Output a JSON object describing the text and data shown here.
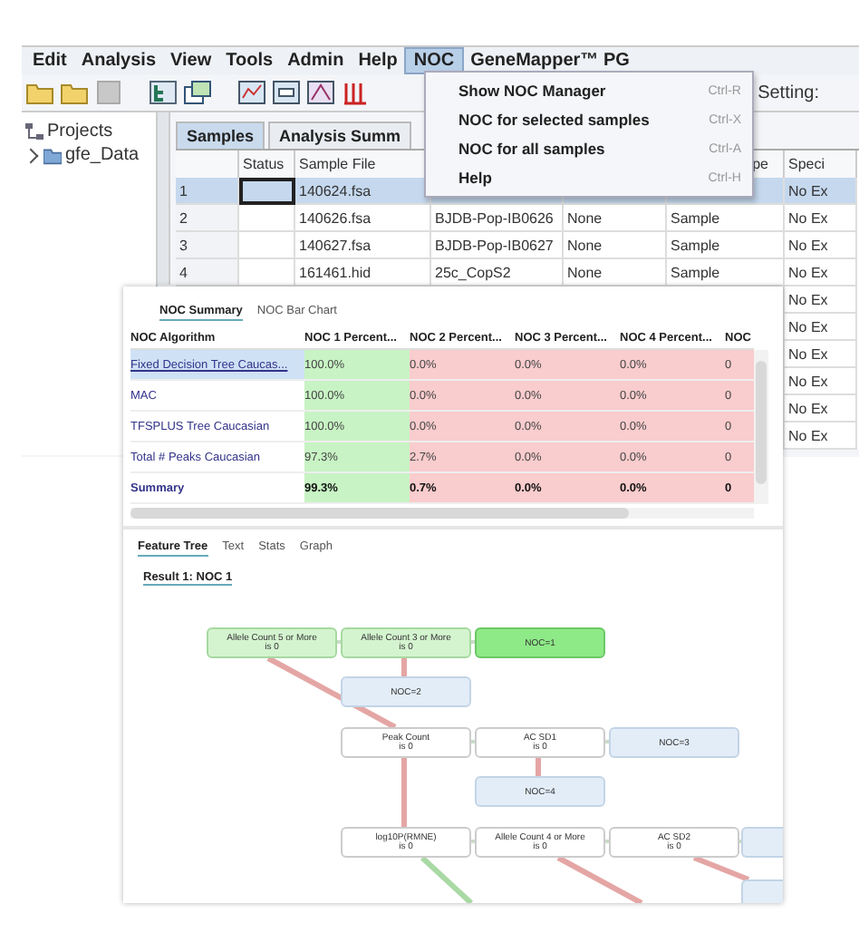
{
  "main_window": {
    "menu_bar": [
      {
        "label": "Edit",
        "selected": false
      },
      {
        "label": "Analysis",
        "selected": false
      },
      {
        "label": "View",
        "selected": false
      },
      {
        "label": "Tools",
        "selected": false
      },
      {
        "label": "Admin",
        "selected": false
      },
      {
        "label": "Help",
        "selected": false
      },
      {
        "label": "NOC",
        "selected": true
      },
      {
        "label": "GeneMapper™ PG",
        "selected": false
      }
    ],
    "toolbar": {
      "setting_label": "Setting:"
    },
    "noc_menu": [
      {
        "label": "Show NOC Manager",
        "shortcut": "Ctrl-R"
      },
      {
        "label": "NOC for selected samples",
        "shortcut": "Ctrl-X"
      },
      {
        "label": "NOC for all samples",
        "shortcut": "Ctrl-A"
      },
      {
        "label": "Help",
        "shortcut": "Ctrl-H"
      }
    ],
    "project_tree": [
      {
        "label": "Projects",
        "children": [
          {
            "label": "gfe_Data"
          }
        ]
      }
    ],
    "tabs": [
      {
        "label": "Samples",
        "selected": true
      },
      {
        "label": "Analysis Summ",
        "selected": false
      }
    ],
    "table": {
      "columns": [
        "Status",
        "Sample File",
        null,
        null,
        "pe",
        "Speci"
      ],
      "rows": [
        {
          "number": "1",
          "sample_file": "140624.fsa",
          "specimen": "No Ex",
          "selected": true
        },
        {
          "number": "2",
          "sample_file": "140626.fsa",
          "sample_name": "BJDB-Pop-IB0626",
          "panel": "None",
          "type": "Sample",
          "specimen": "No Ex",
          "selected": false
        },
        {
          "number": "3",
          "sample_file": "140627.fsa",
          "sample_name": "BJDB-Pop-IB0627",
          "panel": "None",
          "type": "Sample",
          "specimen": "No Ex",
          "selected": false
        },
        {
          "number": "4",
          "sample_file": "161461.hid",
          "sample_name": "25c_CopS2",
          "panel": "None",
          "type": "Sample",
          "specimen": "No Ex",
          "selected": false
        },
        {
          "specimen": "No Ex"
        },
        {
          "specimen": "No Ex"
        },
        {
          "specimen": "No Ex"
        },
        {
          "specimen": "No Ex"
        },
        {
          "specimen": "No Ex"
        },
        {
          "specimen": "No Ex"
        }
      ]
    }
  },
  "noc_panel": {
    "tabs": [
      {
        "label": "NOC Summary",
        "selected": true
      },
      {
        "label": "NOC Bar Chart",
        "selected": false
      }
    ],
    "summary_table": {
      "columns": [
        {
          "label": "NOC Algorithm"
        },
        {
          "label": "NOC 1 Percent...",
          "passed": true
        },
        {
          "label": "NOC 2 Percent...",
          "passed": false
        },
        {
          "label": "NOC 3 Percent...",
          "passed": false
        },
        {
          "label": "NOC 4 Percent...",
          "passed": false
        },
        {
          "label": "NOC",
          "passed": false
        }
      ],
      "rows": [
        {
          "kind": "link",
          "selected": true,
          "cells": [
            "Fixed Decision Tree Caucas...",
            "100.0%",
            "0.0%",
            "0.0%",
            "0.0%",
            "0"
          ]
        },
        {
          "kind": "plain",
          "selected": false,
          "cells": [
            "MAC",
            "100.0%",
            "0.0%",
            "0.0%",
            "0.0%",
            "0"
          ]
        },
        {
          "kind": "plain",
          "selected": false,
          "cells": [
            "TFSPLUS Tree Caucasian",
            "100.0%",
            "0.0%",
            "0.0%",
            "0.0%",
            "0"
          ]
        },
        {
          "kind": "plain",
          "selected": false,
          "cells": [
            "Total # Peaks Caucasian",
            "97.3%",
            "2.7%",
            "0.0%",
            "0.0%",
            "0"
          ]
        },
        {
          "kind": "summary",
          "selected": false,
          "cells": [
            "Summary",
            "99.3%",
            "0.7%",
            "0.0%",
            "0.0%",
            "0"
          ]
        }
      ]
    },
    "result_tabs": [
      {
        "label": "Feature Tree",
        "selected": true
      },
      {
        "label": "Text",
        "selected": false
      },
      {
        "label": "Stats",
        "selected": false
      },
      {
        "label": "Graph",
        "selected": false
      }
    ],
    "result_heading": "Result 1: NOC 1",
    "tree_nodes": [
      {
        "kind": "condition",
        "highlighted": true,
        "label": "Allele Count 5 or More",
        "test": "is 0"
      },
      {
        "kind": "condition",
        "highlighted": true,
        "label": "Allele Count 3 or More",
        "test": "is 0"
      },
      {
        "kind": "outcome",
        "highlighted": true,
        "label": "NOC=1"
      },
      {
        "kind": "outcome",
        "highlighted": false,
        "label": "NOC=2"
      },
      {
        "kind": "condition",
        "highlighted": false,
        "label": "Peak Count",
        "test": "is 0"
      },
      {
        "kind": "condition",
        "highlighted": false,
        "label": "AC SD1",
        "test": "is 0"
      },
      {
        "kind": "outcome",
        "highlighted": false,
        "label": "NOC=3"
      },
      {
        "kind": "outcome",
        "highlighted": false,
        "label": "NOC=4"
      },
      {
        "kind": "condition",
        "highlighted": false,
        "label": "log10P(RMNE)",
        "test": "is 0"
      },
      {
        "kind": "condition",
        "highlighted": false,
        "label": "Allele Count 4 or More",
        "test": "is 0"
      },
      {
        "kind": "condition",
        "highlighted": false,
        "label": "AC SD2",
        "test": "is 0"
      },
      {
        "kind": "outcome",
        "highlighted": false
      },
      {
        "kind": "outcome",
        "highlighted": false
      }
    ]
  }
}
